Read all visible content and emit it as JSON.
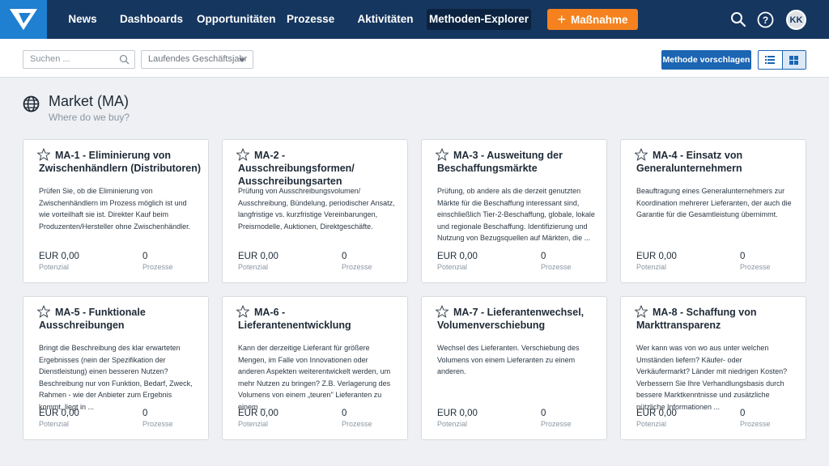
{
  "nav": {
    "items": [
      "News",
      "Dashboards",
      "Opportunitäten",
      "Prozesse",
      "Aktivitäten",
      "Methoden-Explorer"
    ],
    "cta_label": "Maßnahme",
    "avatar_initials": "KK",
    "brand_color": "#15365f",
    "accent_color": "#f5821f"
  },
  "toolbar": {
    "search_placeholder": "Suchen ...",
    "period_value": "Laufendes Geschäftsjahr",
    "suggest_button": "Methode vorschlagen",
    "view_icons": [
      "list-view-icon",
      "grid-view-icon"
    ]
  },
  "section": {
    "title": "Market (MA)",
    "subtitle": "Where do we buy?",
    "icon": "globe-icon"
  },
  "cards": [
    {
      "title": "MA-1 - Eliminierung von Zwischenhändlern (Distributoren)",
      "desc": "Prüfen Sie, ob die Eliminierung von Zwischenhändlern im Prozess möglich ist und wie vorteilhaft sie ist. Direkter Kauf beim Produzenten/Hersteller ohne Zwischenhändler.",
      "potential": "EUR 0,00",
      "potential_label": "Potenzial",
      "processes": "0",
      "processes_label": "Prozesse"
    },
    {
      "title": "MA-2 - Ausschreibungsformen/ Ausschreibungsarten",
      "desc": "Prüfung von Ausschreibungsvolumen/ Ausschreibung, Bündelung, periodischer Ansatz, langfristige vs. kurzfristige Vereinbarungen, Preismodelle, Auktionen, Direktgeschäfte.",
      "potential": "EUR 0,00",
      "potential_label": "Potenzial",
      "processes": "0",
      "processes_label": "Prozesse"
    },
    {
      "title": "MA-3 - Ausweitung der Beschaffungsmärkte",
      "desc": "Prüfung, ob andere als die derzeit genutzten Märkte für die Beschaffung interessant sind, einschließlich Tier-2-Beschaffung, globale, lokale und regionale Beschaffung. Identifizierung und Nutzung von Bezugsquellen auf Märkten, die ...",
      "potential": "EUR 0,00",
      "potential_label": "Potenzial",
      "processes": "0",
      "processes_label": "Prozesse"
    },
    {
      "title": "MA-4 - Einsatz von Generalunternehmern",
      "desc": "Beauftragung eines Generalunternehmers zur Koordination mehrerer Lieferanten, der auch die Garantie für die Gesamtleistung übernimmt.",
      "potential": "EUR 0,00",
      "potential_label": "Potenzial",
      "processes": "0",
      "processes_label": "Prozesse"
    },
    {
      "title": "MA-5 - Funktionale Ausschreibungen",
      "desc": "Bringt die Beschreibung des klar erwarteten Ergebnisses (nein der Spezifikation der Dienstleistung) einen besseren Nutzen? Beschreibung nur von Funktion, Bedarf, Zweck, Rahmen - wie der Anbieter zum Ergebnis kommt, liegt in ...",
      "potential": "EUR 0,00",
      "potential_label": "Potenzial",
      "processes": "0",
      "processes_label": "Prozesse"
    },
    {
      "title": "MA-6 - Lieferantenentwicklung",
      "desc": "Kann der derzeitige Lieferant für größere Mengen, im Falle von Innovationen oder anderen Aspekten weiterentwickelt werden, um mehr Nutzen zu bringen? Z.B. Verlagerung des Volumens von einem „teuren\" Lieferanten zu einem ...",
      "potential": "EUR 0,00",
      "potential_label": "Potenzial",
      "processes": "0",
      "processes_label": "Prozesse"
    },
    {
      "title": "MA-7 - Lieferantenwechsel, Volumenverschiebung",
      "desc": "Wechsel des Lieferanten. Verschiebung des Volumens von einem Lieferanten zu einem anderen.",
      "potential": "EUR 0,00",
      "potential_label": "Potenzial",
      "processes": "0",
      "processes_label": "Prozesse"
    },
    {
      "title": "MA-8 - Schaffung von Markttransparenz",
      "desc": "Wer kann was von wo aus unter welchen Umständen liefern? Käufer- oder Verkäufermarkt? Länder mit niedrigen Kosten? Verbessern Sie Ihre Verhandlungsbasis durch bessere Marktkenntnisse und zusätzliche nützliche Informationen ...",
      "potential": "EUR 0,00",
      "potential_label": "Potenzial",
      "processes": "0",
      "processes_label": "Prozesse"
    }
  ]
}
